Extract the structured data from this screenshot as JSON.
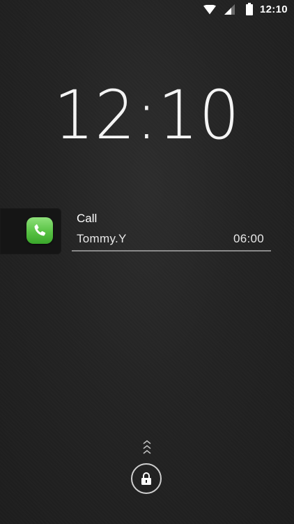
{
  "status_bar": {
    "time": "12:10",
    "icons": [
      "wifi-icon",
      "cellular-signal-icon",
      "battery-icon"
    ]
  },
  "lockscreen": {
    "clock": "12:10"
  },
  "notification": {
    "app_icon": "phone-call-icon",
    "title": "Call",
    "caller": "Tommy.Y",
    "time": "06:00"
  },
  "unlock": {
    "hint_icon": "chevron-up-double-icon",
    "button_icon": "lock-icon"
  },
  "colors": {
    "background": "#222222",
    "call_icon_green": "#58c244",
    "divider": "#8a8a8a"
  }
}
